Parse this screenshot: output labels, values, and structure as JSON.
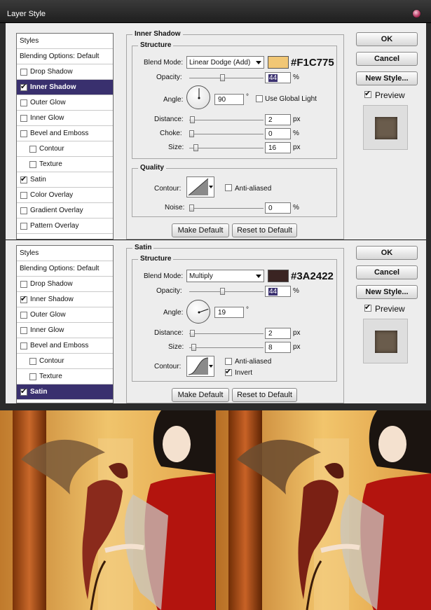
{
  "window": {
    "title": "Layer Style"
  },
  "panel1": {
    "styles_list": [
      {
        "label": "Styles",
        "kind": "head"
      },
      {
        "label": "Blending Options: Default",
        "kind": "head"
      },
      {
        "label": "Drop Shadow",
        "checked": false
      },
      {
        "label": "Inner Shadow",
        "checked": true,
        "selected": true
      },
      {
        "label": "Outer Glow",
        "checked": false
      },
      {
        "label": "Inner Glow",
        "checked": false
      },
      {
        "label": "Bevel and Emboss",
        "checked": false
      },
      {
        "label": "Contour",
        "checked": false,
        "sub": true
      },
      {
        "label": "Texture",
        "checked": false,
        "sub": true
      },
      {
        "label": "Satin",
        "checked": true
      },
      {
        "label": "Color Overlay",
        "checked": false
      },
      {
        "label": "Gradient Overlay",
        "checked": false
      },
      {
        "label": "Pattern Overlay",
        "checked": false
      }
    ],
    "group_title": "Inner Shadow",
    "structure_title": "Structure",
    "blend_mode_label": "Blend Mode:",
    "blend_mode": "Linear Dodge (Add)",
    "color_hex": "#F1C775",
    "opacity_label": "Opacity:",
    "opacity": "44",
    "opacity_fraction": 0.44,
    "percent": "%",
    "angle_label": "Angle:",
    "angle": "90",
    "angle_degrees": 90,
    "degree": "°",
    "use_global_light": "Use Global Light",
    "use_global_light_checked": false,
    "distance_label": "Distance:",
    "distance": "2",
    "distance_fraction": 0.01,
    "choke_label": "Choke:",
    "choke": "0",
    "choke_fraction": 0.0,
    "size_label": "Size:",
    "size": "16",
    "size_fraction": 0.065,
    "px": "px",
    "quality_title": "Quality",
    "contour_label": "Contour:",
    "anti_aliased": "Anti-aliased",
    "anti_aliased_checked": false,
    "noise_label": "Noise:",
    "noise": "0",
    "noise_fraction": 0.0,
    "make_default": "Make Default",
    "reset_to_default": "Reset to Default"
  },
  "panel2": {
    "styles_list": [
      {
        "label": "Styles",
        "kind": "head"
      },
      {
        "label": "Blending Options: Default",
        "kind": "head"
      },
      {
        "label": "Drop Shadow",
        "checked": false
      },
      {
        "label": "Inner Shadow",
        "checked": true
      },
      {
        "label": "Outer Glow",
        "checked": false
      },
      {
        "label": "Inner Glow",
        "checked": false
      },
      {
        "label": "Bevel and Emboss",
        "checked": false
      },
      {
        "label": "Contour",
        "checked": false,
        "sub": true
      },
      {
        "label": "Texture",
        "checked": false,
        "sub": true
      },
      {
        "label": "Satin",
        "checked": true,
        "selected": true
      }
    ],
    "group_title": "Satin",
    "structure_title": "Structure",
    "blend_mode_label": "Blend Mode:",
    "blend_mode": "Multiply",
    "color_hex": "#3A2422",
    "opacity_label": "Opacity:",
    "opacity": "44",
    "opacity_fraction": 0.44,
    "percent": "%",
    "angle_label": "Angle:",
    "angle": "19",
    "angle_degrees": 19,
    "degree": "°",
    "distance_label": "Distance:",
    "distance": "2",
    "distance_fraction": 0.01,
    "size_label": "Size:",
    "size": "8",
    "size_fraction": 0.035,
    "px": "px",
    "contour_label": "Contour:",
    "anti_aliased": "Anti-aliased",
    "anti_aliased_checked": false,
    "invert": "Invert",
    "invert_checked": true,
    "make_default": "Make Default",
    "reset_to_default": "Reset to Default"
  },
  "side_buttons": {
    "ok": "OK",
    "cancel": "Cancel",
    "new_style": "New Style...",
    "preview": "Preview",
    "preview_checked": true
  },
  "colors": {
    "selection": "#39306e",
    "inner_shadow_color": "#F1C775",
    "satin_color": "#3A2422",
    "preview_fill": "#6a5c4c"
  },
  "icons": {
    "close": "close-orb-icon",
    "dial": "angle-dial-icon",
    "contour": "contour-curve-icon",
    "checkbox": "checkbox-icon"
  }
}
